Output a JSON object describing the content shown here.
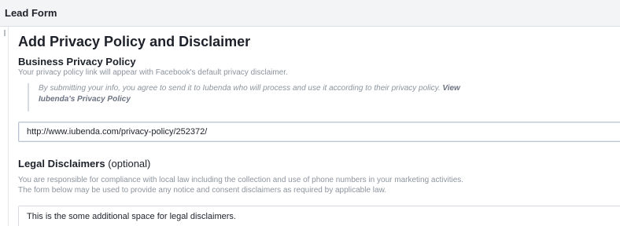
{
  "header": {
    "title": "Lead Form"
  },
  "section": {
    "title": "Add Privacy Policy and Disclaimer"
  },
  "business_privacy": {
    "title": "Business Privacy Policy",
    "description": "Your privacy policy link will appear with Facebook's default privacy disclaimer.",
    "disclaimer_text": "By submitting your info, you agree to send it to Iubenda who will process and use it according to their privacy policy.",
    "disclaimer_link": "View Iubenda's Privacy Policy",
    "url_value": "http://www.iubenda.com/privacy-policy/252372/"
  },
  "legal": {
    "title": "Legal Disclaimers",
    "optional": "(optional)",
    "line1": "You are responsible for compliance with local law including the collection and use of phone numbers in your marketing activities.",
    "line2": "The form below may be used to provide any notice and consent disclaimers as required by applicable law.",
    "textarea_value": "This is the some additional space for legal disclaimers."
  }
}
